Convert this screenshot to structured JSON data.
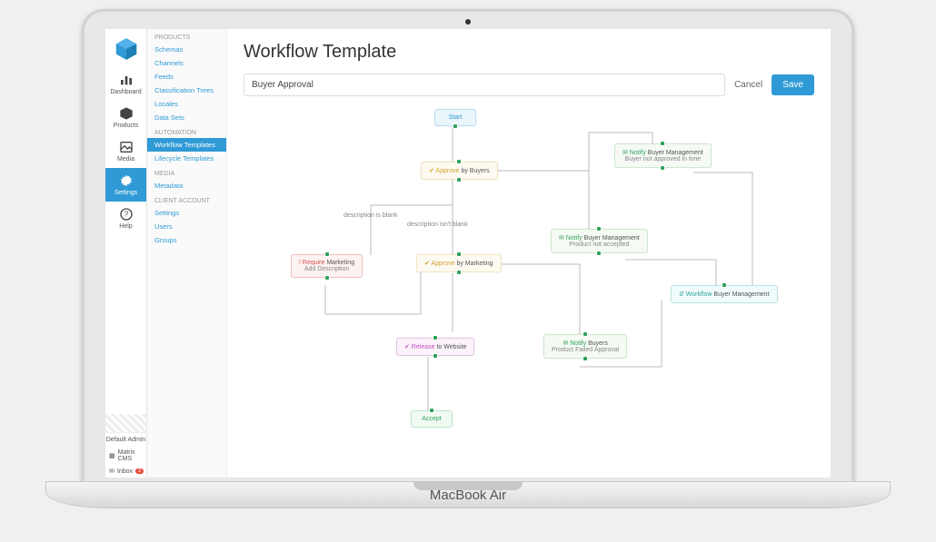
{
  "iconbar": {
    "items": [
      {
        "key": "dashboard",
        "label": "Dashboard"
      },
      {
        "key": "products",
        "label": "Products"
      },
      {
        "key": "media",
        "label": "Media"
      },
      {
        "key": "settings",
        "label": "Settings"
      },
      {
        "key": "help",
        "label": "Help"
      }
    ],
    "user": "Default Admin",
    "account": "Matrix CMS",
    "inbox_label": "Inbox",
    "inbox_count": "2"
  },
  "subnav": {
    "groups": [
      {
        "label": "Products",
        "items": [
          "Schemas",
          "Channels",
          "Feeds",
          "Classification Trees",
          "Locales",
          "Data Sets"
        ]
      },
      {
        "label": "Automation",
        "items": [
          "Workflow Templates",
          "Lifecycle Templates"
        ]
      },
      {
        "label": "Media",
        "items": [
          "Metadata"
        ]
      },
      {
        "label": "Client Account",
        "items": [
          "Settings",
          "Users",
          "Groups"
        ]
      }
    ],
    "active": "Workflow Templates"
  },
  "page": {
    "title": "Workflow Template",
    "name_value": "Buyer Approval",
    "cancel": "Cancel",
    "save": "Save"
  },
  "edge_labels": {
    "blank": "description is blank",
    "not_blank": "description isn't blank"
  },
  "nodes": {
    "start": {
      "text": "Start"
    },
    "approve1": {
      "kw": "✔ Approve",
      "text": " by Buyers"
    },
    "approve2": {
      "kw": "✔ Approve",
      "text": " by Marketing"
    },
    "require": {
      "kw": "! Require",
      "text": " Marketing",
      "sub": "Add Description"
    },
    "release": {
      "kw": "✔ Release",
      "text": " to Website"
    },
    "accept": {
      "text": "Accept"
    },
    "notify_time": {
      "kw": "✉ Notify",
      "text": " Buyer Management",
      "sub": "Buyer not approved in time"
    },
    "notify_na": {
      "kw": "✉ Notify",
      "text": " Buyer Management",
      "sub": "Product not accepted"
    },
    "notify_fail": {
      "kw": "✉ Notify",
      "text": " Buyers",
      "sub": "Product Failed Approval"
    },
    "wf_mgmt": {
      "kw": "⇵ Workflow",
      "text": " Buyer Management"
    }
  },
  "laptop_brand": "MacBook Air"
}
